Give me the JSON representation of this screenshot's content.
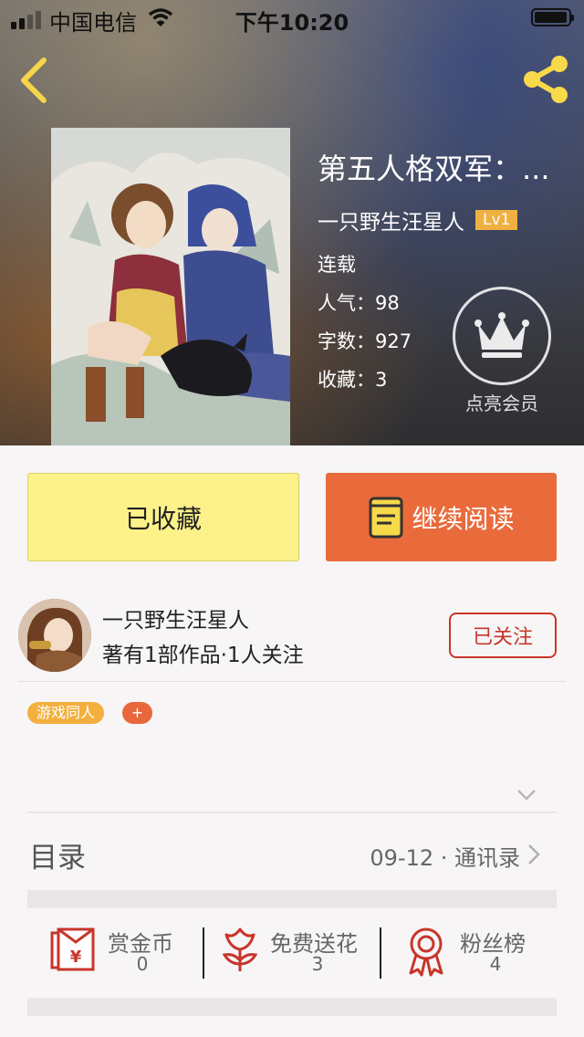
{
  "status_bar": {
    "carrier": "中国电信",
    "time": "下午10:20"
  },
  "book": {
    "title": "第五人格双军：...",
    "author": "一只野生汪星人",
    "level": "Lv1",
    "status": "连载",
    "popularity_label": "人气：",
    "popularity": "98",
    "words_label": "字数：",
    "words": "927",
    "favorites_label": "收藏：",
    "favorites": "3"
  },
  "vip": {
    "label": "点亮会员"
  },
  "actions": {
    "collected": "已收藏",
    "continue_reading": "继续阅读"
  },
  "author": {
    "name": "一只野生汪星人",
    "meta": "著有1部作品·1人关注",
    "follow": "已关注"
  },
  "tags": [
    {
      "label": "游戏同人"
    }
  ],
  "tag_add": "+",
  "toc": {
    "title": "目录",
    "latest": "09-12 · 通讯录"
  },
  "rewards": [
    {
      "label": "赏金币",
      "count": "0",
      "icon": "red-envelope-icon"
    },
    {
      "label": "免费送花",
      "count": "3",
      "icon": "flower-icon"
    },
    {
      "label": "粉丝榜",
      "count": "4",
      "icon": "medal-icon"
    }
  ],
  "colors": {
    "accent_orange": "#e96b3c",
    "collect_yellow": "#fdf28a",
    "icon_red": "#c8352a",
    "level_badge": "#f0b040",
    "share_yellow": "#f7d94a"
  }
}
